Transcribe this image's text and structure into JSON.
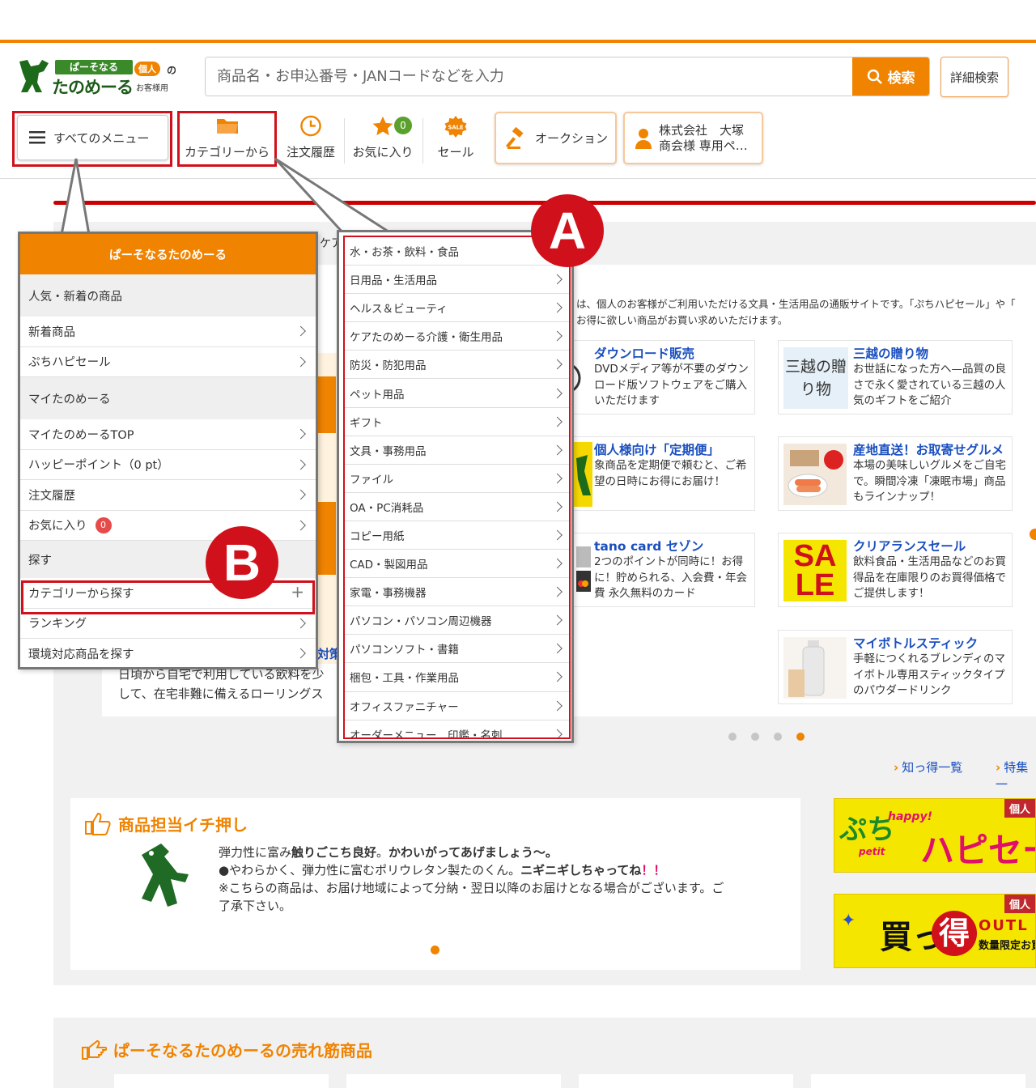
{
  "header": {
    "logo_badge": "ぱーそなる",
    "logo_main": "たのめーる",
    "logo_personal": "個人",
    "logo_no": "の",
    "logo_sub": "お客様用",
    "search_placeholder": "商品名・お申込番号・JANコードなどを入力",
    "search_button": "検索",
    "advanced_search": "詳細検索"
  },
  "nav": {
    "all_menu": "すべてのメニュー",
    "category": "カテゴリーから",
    "order_history": "注文履歴",
    "favorites": "お気に入り",
    "favorites_count": "0",
    "sale": "セール",
    "auction": "オークション",
    "account_line1": "株式会社　大塚",
    "account_line2": "商会様 専用ペ…"
  },
  "intro_text": "は、個人のお客様がご利用いただける文具・生活用品の通販サイトです。「ぷちハピセール」や「　　お得に欲しい商品がお買い求めいただけます。",
  "products": [
    {
      "title": "ダウンロード販売",
      "desc": "DVDメディア等が不要のダウンロード版ソフトウェアをご購入いただけます"
    },
    {
      "title": "三越の贈り物",
      "desc": "お世話になった方へ—品質の良さで永く愛されている三越の人気のギフトをご紹介",
      "img_text": "三越の贈り物"
    },
    {
      "title": "個人様向け「定期便」",
      "desc": "象商品を定期便で頼むと、ご希望の日時にお得にお届け！"
    },
    {
      "title": "産地直送！お取寄せグルメ",
      "desc": "本場の美味しいグルメをご自宅で。瞬間冷凍「凍眠市場」商品もラインナップ！"
    },
    {
      "title": "tano card セゾン",
      "desc": "2つのポイントが同時に！お得に！貯められる、入会費・年会費 永久無料のカード"
    },
    {
      "title": "クリアランスセール",
      "desc": "飲料食品・生活用品などのお買得品を在庫限りのお買得価格でご提供します！",
      "img_text_1": "SA",
      "img_text_2": "LE"
    },
    {
      "title": "マイボトルスティック",
      "desc": "手軽につくれるブレンディのマイボトル専用スティックタイプのパウダードリンク"
    }
  ],
  "links": {
    "knowledge": "知っ得一覧",
    "feature": "特集一"
  },
  "partial_texts": {
    "care": "ケア",
    "taisaku": "対策",
    "line1": "日頃から自宅で利用している飲料を少",
    "line2": "して、在宅非難に備えるローリングス"
  },
  "recommend": {
    "heading": "商品担当イチ押し",
    "line1_a": "弾力性に富み",
    "line1_b": "触りごこち良好",
    "line1_c": "。",
    "line1_d": "かわいがってあげましょう〜。",
    "line2_a": "●やわらかく、弾力性に富むポリウレタン製たのくん。",
    "line2_b": "ニギニギしちゃってね",
    "line2_c": "！！",
    "line3": "※こちらの商品は、お届け地域によって分納・翌日以降のお届けとなる場合がございます。ご了承下さい。"
  },
  "banners": {
    "petit_tag": "個人",
    "petit_main": "ぷち",
    "petit_happy": "happy!",
    "petit_petit": "petit",
    "petit_hapi": "ハピセー",
    "outlet_tag": "個人",
    "outlet_main": "買っ",
    "outlet_toku": "得",
    "outlet_word": "OUTL",
    "outlet_sub": "数量限定お買"
  },
  "bestseller_heading": "ぱーそなるたのめーるの売れ筋商品",
  "left_panel": {
    "header": "ぱーそなるたのめーる",
    "sections": [
      {
        "title": "人気・新着の商品",
        "items": [
          "新着商品",
          "ぷちハピセール"
        ]
      },
      {
        "title": "マイたのめーる",
        "items": [
          "マイたのめーるTOP",
          "ハッピーポイント（0 pt）",
          "注文履歴",
          "お気に入り"
        ]
      },
      {
        "title": "探す",
        "items": [
          "カテゴリーから探す",
          "ランキング",
          "環境対応商品を探す"
        ]
      }
    ],
    "favorites_badge": "0"
  },
  "categories": [
    "水・お茶・飲料・食品",
    "日用品・生活用品",
    "ヘルス＆ビューティ",
    "ケアたのめーる介護・衛生用品",
    "防災・防犯用品",
    "ペット用品",
    "ギフト",
    "文具・事務用品",
    "ファイル",
    "OA・PC消耗品",
    "コピー用紙",
    "CAD・製図用品",
    "家電・事務機器",
    "パソコン・パソコン周辺機器",
    "パソコンソフト・書籍",
    "梱包・工具・作業用品",
    "オフィスファニチャー",
    "オーダーメニュー　印鑑・名刺"
  ],
  "callouts": {
    "a": "A",
    "b": "B"
  },
  "colors": {
    "brand_orange": "#f08300",
    "annotation_red": "#d0101a",
    "link_blue": "#1a4fbf"
  }
}
